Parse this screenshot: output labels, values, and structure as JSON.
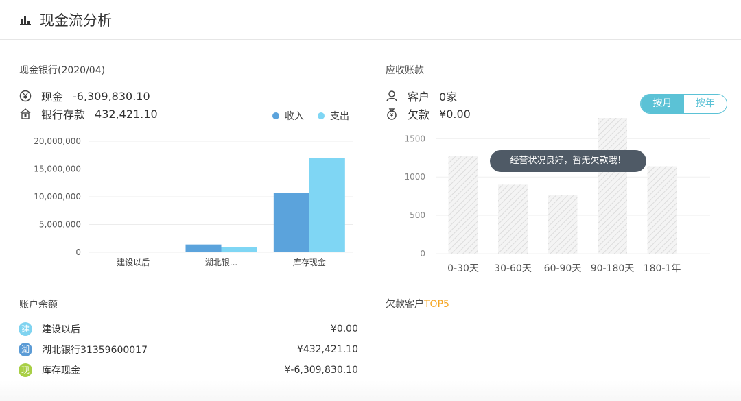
{
  "header": {
    "title": "现金流分析",
    "icon": "bar-chart-icon"
  },
  "cash_bank": {
    "title": "现金银行(2020/04)",
    "cash_label": "现金",
    "cash_value": "-6,309,830.10",
    "bank_label": "银行存款",
    "bank_value": "432,421.10",
    "legend_income": "收入",
    "legend_expense": "支出"
  },
  "receivables": {
    "title": "应收账款",
    "customer_label": "客户",
    "customer_value": "0家",
    "debt_label": "欠款",
    "debt_value": "¥0.00",
    "toggle_month": "按月",
    "toggle_year": "按年",
    "tooltip": "经营状况良好，暂无欠款哦！",
    "top5_prefix": "欠款客户",
    "top5_accent": "TOP5"
  },
  "accounts": {
    "title": "账户余额",
    "items": [
      {
        "badge": "建",
        "name": "建设以后",
        "amount": "¥0.00",
        "color": "#7fd3f0"
      },
      {
        "badge": "湖",
        "name": "湖北银行31359600017",
        "amount": "¥432,421.10",
        "color": "#5b9bd5"
      },
      {
        "badge": "现",
        "name": "库存现金",
        "amount": "¥-6,309,830.10",
        "color": "#a8cf45"
      }
    ]
  },
  "colors": {
    "income": "#5ba3dc",
    "expense": "#7fd6f4",
    "accent": "#5bc2d6",
    "top5": "#f5a623"
  },
  "chart_data": [
    {
      "type": "bar",
      "categories": [
        "建设以后",
        "湖北银...",
        "库存现金"
      ],
      "series": [
        {
          "name": "收入",
          "values": [
            0,
            1400000,
            10700000
          ]
        },
        {
          "name": "支出",
          "values": [
            0,
            900000,
            17000000
          ]
        }
      ],
      "ylim": [
        0,
        20000000
      ],
      "yticks": [
        "0",
        "5,000,000",
        "10,000,000",
        "15,000,000",
        "20,000,000"
      ],
      "grid": true,
      "legend": "top-right"
    },
    {
      "type": "bar",
      "categories": [
        "0-30天",
        "30-60天",
        "60-90天",
        "90-180天",
        "180-1年"
      ],
      "values": [
        1270,
        900,
        760,
        1900,
        1140
      ],
      "ylim": [
        0,
        1700
      ],
      "yticks": [
        "0",
        "500",
        "1000",
        "1500"
      ],
      "grid": true
    }
  ]
}
